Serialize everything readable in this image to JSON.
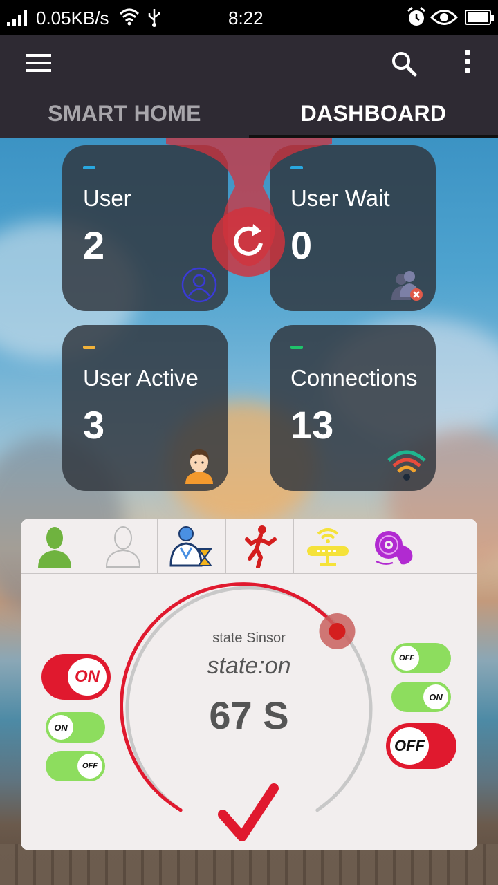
{
  "status_bar": {
    "net_speed": "0.05KB/s",
    "time": "8:22",
    "icons": [
      "signal-icon",
      "wifi-icon",
      "usb-icon",
      "alarm-icon",
      "eye-icon",
      "battery-icon"
    ]
  },
  "app_bar": {
    "icons": [
      "menu-icon",
      "search-icon",
      "more-vert-icon"
    ],
    "tabs": [
      {
        "label": "SMART HOME",
        "selected": false
      },
      {
        "label": "DASHBOARD",
        "selected": true
      }
    ]
  },
  "cards": [
    {
      "label": "User",
      "value": "2",
      "accent": "#29a8e0",
      "icon": "user-circle-icon"
    },
    {
      "label": "User Wait",
      "value": "0",
      "accent": "#29a8e0",
      "icon": "users-removed-icon"
    },
    {
      "label": "User Active",
      "value": "3",
      "accent": "#f2b23a",
      "icon": "person-avatar-icon"
    },
    {
      "label": "Connections",
      "value": "13",
      "accent": "#1fc36a",
      "icon": "wifi-signal-icon"
    }
  ],
  "refresh": {
    "icon": "refresh-icon",
    "color": "#d2323c"
  },
  "panel": {
    "mode_icons": [
      "user-green-icon",
      "user-outline-icon",
      "user-hourglass-icon",
      "running-man-icon",
      "router-icon",
      "disc-hand-icon"
    ],
    "gauge": {
      "title": "state Sinsor",
      "state": "state:on",
      "count": "67 S",
      "progress": 0.42,
      "active_color": "#e0192e",
      "track_color": "#c8c8c8",
      "check_icon": "checkmark-icon"
    },
    "left_toggles": [
      {
        "label": "ON",
        "style": "red",
        "on": true
      },
      {
        "label": "ON",
        "style": "green",
        "on": true
      },
      {
        "label": "OFF",
        "style": "green",
        "on": false
      }
    ],
    "right_toggles": [
      {
        "label": "OFF",
        "style": "green",
        "on": false
      },
      {
        "label": "ON",
        "style": "green",
        "on": true
      },
      {
        "label": "OFF",
        "style": "red",
        "on": false
      }
    ]
  }
}
